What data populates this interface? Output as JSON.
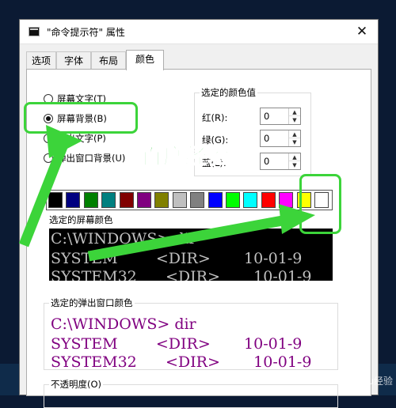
{
  "window": {
    "title": "\"命令提示符\" 属性",
    "close_icon": "close-icon"
  },
  "tabs": [
    {
      "label": "选项",
      "active": false
    },
    {
      "label": "字体",
      "active": false
    },
    {
      "label": "布局",
      "active": false
    },
    {
      "label": "颜色",
      "active": true
    }
  ],
  "radio_group": [
    {
      "label": "屏幕文字(T)",
      "checked": false
    },
    {
      "label": "屏幕背景(B)",
      "checked": true
    },
    {
      "label": "弹出文字(P)",
      "checked": false
    },
    {
      "label": "弹出窗口背景(U)",
      "checked": false
    }
  ],
  "selected_values": {
    "title": "选定的颜色值",
    "red_label": "红(R):",
    "red": "0",
    "green_label": "绿(G):",
    "green": "0",
    "blue_label": "蓝(L):",
    "blue": "0"
  },
  "palette": [
    "#000000",
    "#000080",
    "#008000",
    "#008080",
    "#800000",
    "#800080",
    "#808000",
    "#c0c0c0",
    "#808080",
    "#0000ff",
    "#00ff00",
    "#00ffff",
    "#ff0000",
    "#ff00ff",
    "#ffff00",
    "#ffffff"
  ],
  "screen_preview": {
    "label": "选定的屏幕颜色",
    "background": "#000000",
    "text_color": "#c0c0c0",
    "lines": [
      "C:\\WINDOWS> dir",
      "SYSTEM        <DIR>       10-01-9",
      "SYSTEM32      <DIR>       10-01-9"
    ]
  },
  "popup_preview": {
    "label": "选定的弹出窗口颜色",
    "background": "#ffffff",
    "text_color": "#800080",
    "lines": [
      "C:\\WINDOWS> dir",
      "SYSTEM        <DIR>       10-01-9",
      "SYSTEM32      <DIR>       10-01-9"
    ]
  },
  "opacity": {
    "label": "不透明度(O)"
  },
  "watermark": {
    "text": "百度经验",
    "corner": "Baidu经验"
  },
  "annotation_color": "#3cd43a"
}
